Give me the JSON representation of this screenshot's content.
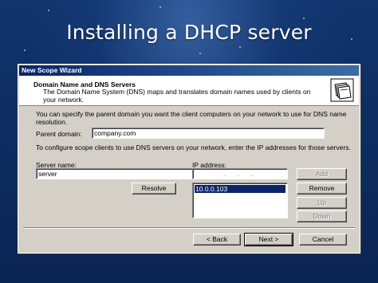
{
  "slide": {
    "title": "Installing a DHCP server"
  },
  "wizard": {
    "window_title": "New Scope Wizard",
    "header_title": "Domain Name and DNS Servers",
    "header_description": "The Domain Name System (DNS) maps and translates domain names used by clients on your network.",
    "header_icon": "folders-icon",
    "intro_text": "You can specify the parent domain you want the client computers on your network to use for DNS name resolution.",
    "parent_domain_label": "Parent domain:",
    "parent_domain_value": "company.com",
    "dns_instruction": "To configure scope clients to use DNS servers on your network, enter the IP addresses for those servers.",
    "server_name_label": "Server name:",
    "server_name_value": "server",
    "ip_address_label": "IP address:",
    "ip_address_value": ". . .",
    "ip_list": [
      "10.0.0.103"
    ],
    "buttons": {
      "resolve": "Resolve",
      "add": "Add",
      "remove": "Remove",
      "up": "Up",
      "down": "Down",
      "back": "< Back",
      "next": "Next >",
      "cancel": "Cancel"
    }
  },
  "colors": {
    "slide_background": "#0c2a5a",
    "titlebar_start": "#0a246a",
    "titlebar_end": "#3a6ea5",
    "dialog_face": "#d4d0c8",
    "selection": "#0a246a"
  }
}
